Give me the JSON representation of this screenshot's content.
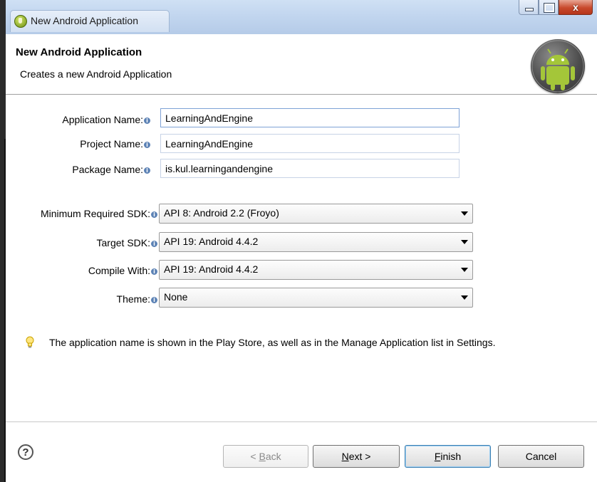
{
  "window": {
    "title": "New Android Application",
    "controls": {
      "minimize": "—",
      "maximize": "□",
      "close": "x"
    }
  },
  "header": {
    "title": "New Android Application",
    "subtitle": "Creates a new Android Application",
    "logo_icon": "android-logo-icon"
  },
  "form": {
    "application_name": {
      "label": "Application Name:",
      "value": "LearningAndEngine"
    },
    "project_name": {
      "label": "Project Name:",
      "value": "LearningAndEngine"
    },
    "package_name": {
      "label": "Package Name:",
      "value": "is.kul.learningandengine"
    },
    "min_sdk": {
      "label": "Minimum Required SDK:",
      "value": "API 8: Android 2.2 (Froyo)"
    },
    "target_sdk": {
      "label": "Target SDK:",
      "value": "API 19: Android 4.4.2"
    },
    "compile_with": {
      "label": "Compile With:",
      "value": "API 19: Android 4.4.2"
    },
    "theme": {
      "label": "Theme:",
      "value": "None"
    },
    "info_glyph": "i"
  },
  "hint": {
    "icon": "lightbulb-icon",
    "text": "The application name is shown in the Play Store, as well as in the Manage Application list in Settings."
  },
  "footer": {
    "help_glyph": "?",
    "back": {
      "mnemonic": "B",
      "rest": "ack",
      "prefix": "< "
    },
    "next": {
      "mnemonic": "N",
      "rest": "ext >"
    },
    "finish": {
      "mnemonic": "F",
      "rest": "inish"
    },
    "cancel": "Cancel"
  },
  "colors": {
    "titlebar": "#c2d6ef",
    "close_button": "#c8492c",
    "info_icon": "#5c82b5",
    "default_button_border": "#3c7fb1"
  }
}
